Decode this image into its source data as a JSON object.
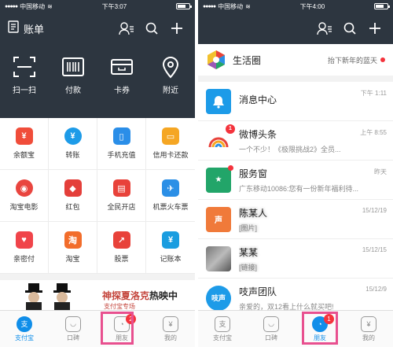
{
  "left": {
    "status": {
      "carrier": "中国移动",
      "time": "下午3:07"
    },
    "topbar": {
      "title": "账单"
    },
    "quick_actions": [
      {
        "label": "扫一扫",
        "icon": "scan-icon"
      },
      {
        "label": "付款",
        "icon": "barcode-icon"
      },
      {
        "label": "卡券",
        "icon": "card-icon"
      },
      {
        "label": "附近",
        "icon": "location-icon"
      }
    ],
    "grid": [
      {
        "label": "余额宝",
        "glyph": "¥",
        "color": "#f04d3a"
      },
      {
        "label": "转账",
        "glyph": "¥",
        "color": "#1d9be8"
      },
      {
        "label": "手机充值",
        "glyph": "▯",
        "color": "#2a8ee8"
      },
      {
        "label": "信用卡还款",
        "glyph": "▭",
        "color": "#f5a623"
      },
      {
        "label": "淘宝电影",
        "glyph": "◉",
        "color": "#e9453f"
      },
      {
        "label": "红包",
        "glyph": "◆",
        "color": "#e43f3a"
      },
      {
        "label": "全民开店",
        "glyph": "▤",
        "color": "#e8423a"
      },
      {
        "label": "机票火车票",
        "glyph": "✈",
        "color": "#2b8fe6"
      },
      {
        "label": "亲密付",
        "glyph": "♥",
        "color": "#f0444a"
      },
      {
        "label": "淘宝",
        "glyph": "淘",
        "color": "#f26d2b"
      },
      {
        "label": "股票",
        "glyph": "↗",
        "color": "#e8423a"
      },
      {
        "label": "记账本",
        "glyph": "¥",
        "color": "#1a9de0"
      }
    ],
    "banner": {
      "title_a": "神探夏洛克",
      "title_b": "热映中",
      "sub": "支付宝专场"
    },
    "tabs": [
      {
        "label": "支付宝",
        "glyph": "支",
        "active": true,
        "badge": ""
      },
      {
        "label": "口碑",
        "glyph": "◡",
        "active": false,
        "badge": ""
      },
      {
        "label": "朋友",
        "glyph": "◔",
        "active": false,
        "badge": "2"
      },
      {
        "label": "我的",
        "glyph": "¥",
        "active": false,
        "badge": ""
      }
    ]
  },
  "right": {
    "status": {
      "carrier": "中国移动",
      "time": "下午4:00"
    },
    "life": {
      "name": "生活圈",
      "sub": "抬下新年的蓝天"
    },
    "messages": [
      {
        "name": "消息中心",
        "preview": "",
        "time": "下午 1:11",
        "color": "#1d9be8",
        "glyph": "🔔",
        "badge": "",
        "dot": false,
        "blur": false
      },
      {
        "name": "微博头条",
        "preview": "一个不少！《极限挑战2》全员...",
        "time": "上午 8:55",
        "color": "#ffffff",
        "glyph": "",
        "badge": "1",
        "dot": false,
        "blur": false
      },
      {
        "name": "服务窗",
        "preview": "广东移动10086:您有一份新年福利待...",
        "time": "昨天",
        "color": "#22a569",
        "glyph": "★",
        "badge": "",
        "dot": true,
        "blur": false
      },
      {
        "name": "陈某人",
        "preview": "[图片]",
        "time": "15/12/19",
        "color": "#f07a3a",
        "glyph": "声",
        "badge": "",
        "dot": false,
        "blur": true
      },
      {
        "name": "某某",
        "preview": "[链接]",
        "time": "15/12/15",
        "color": "#888888",
        "glyph": "",
        "badge": "",
        "dot": false,
        "blur": true
      },
      {
        "name": "吱声团队",
        "preview": "亲爱的，双12看上什么就买吧!",
        "time": "15/12/9",
        "color": "#1d9be8",
        "glyph": "吱声",
        "badge": "",
        "dot": false,
        "blur": false
      }
    ],
    "tabs": [
      {
        "label": "支付宝",
        "glyph": "支",
        "active": false,
        "badge": ""
      },
      {
        "label": "口碑",
        "glyph": "◡",
        "active": false,
        "badge": ""
      },
      {
        "label": "朋友",
        "glyph": "◔",
        "active": true,
        "badge": "1"
      },
      {
        "label": "我的",
        "glyph": "¥",
        "active": false,
        "badge": ""
      }
    ]
  }
}
